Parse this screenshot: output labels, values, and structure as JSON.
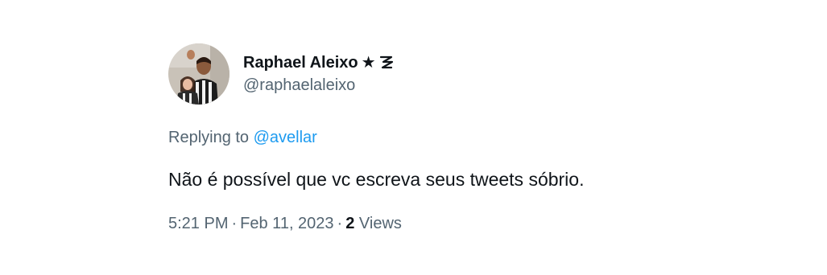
{
  "tweet": {
    "author": {
      "display_name": "Raphael Aleixo",
      "star_glyph": "★",
      "badge_icon": "botafogo-star-badge-icon",
      "handle": "@raphaelaleixo"
    },
    "replying_prefix": "Replying to",
    "replying_to": "@avellar",
    "text": "Não é possível que vc escreva seus tweets sóbrio.",
    "time": "5:21 PM",
    "separator": "·",
    "date": "Feb 11, 2023",
    "views_count": "2",
    "views_label": "Views"
  },
  "colors": {
    "text_primary": "#0f1419",
    "text_secondary": "#536471",
    "link": "#1d9bf0",
    "background": "#ffffff"
  }
}
